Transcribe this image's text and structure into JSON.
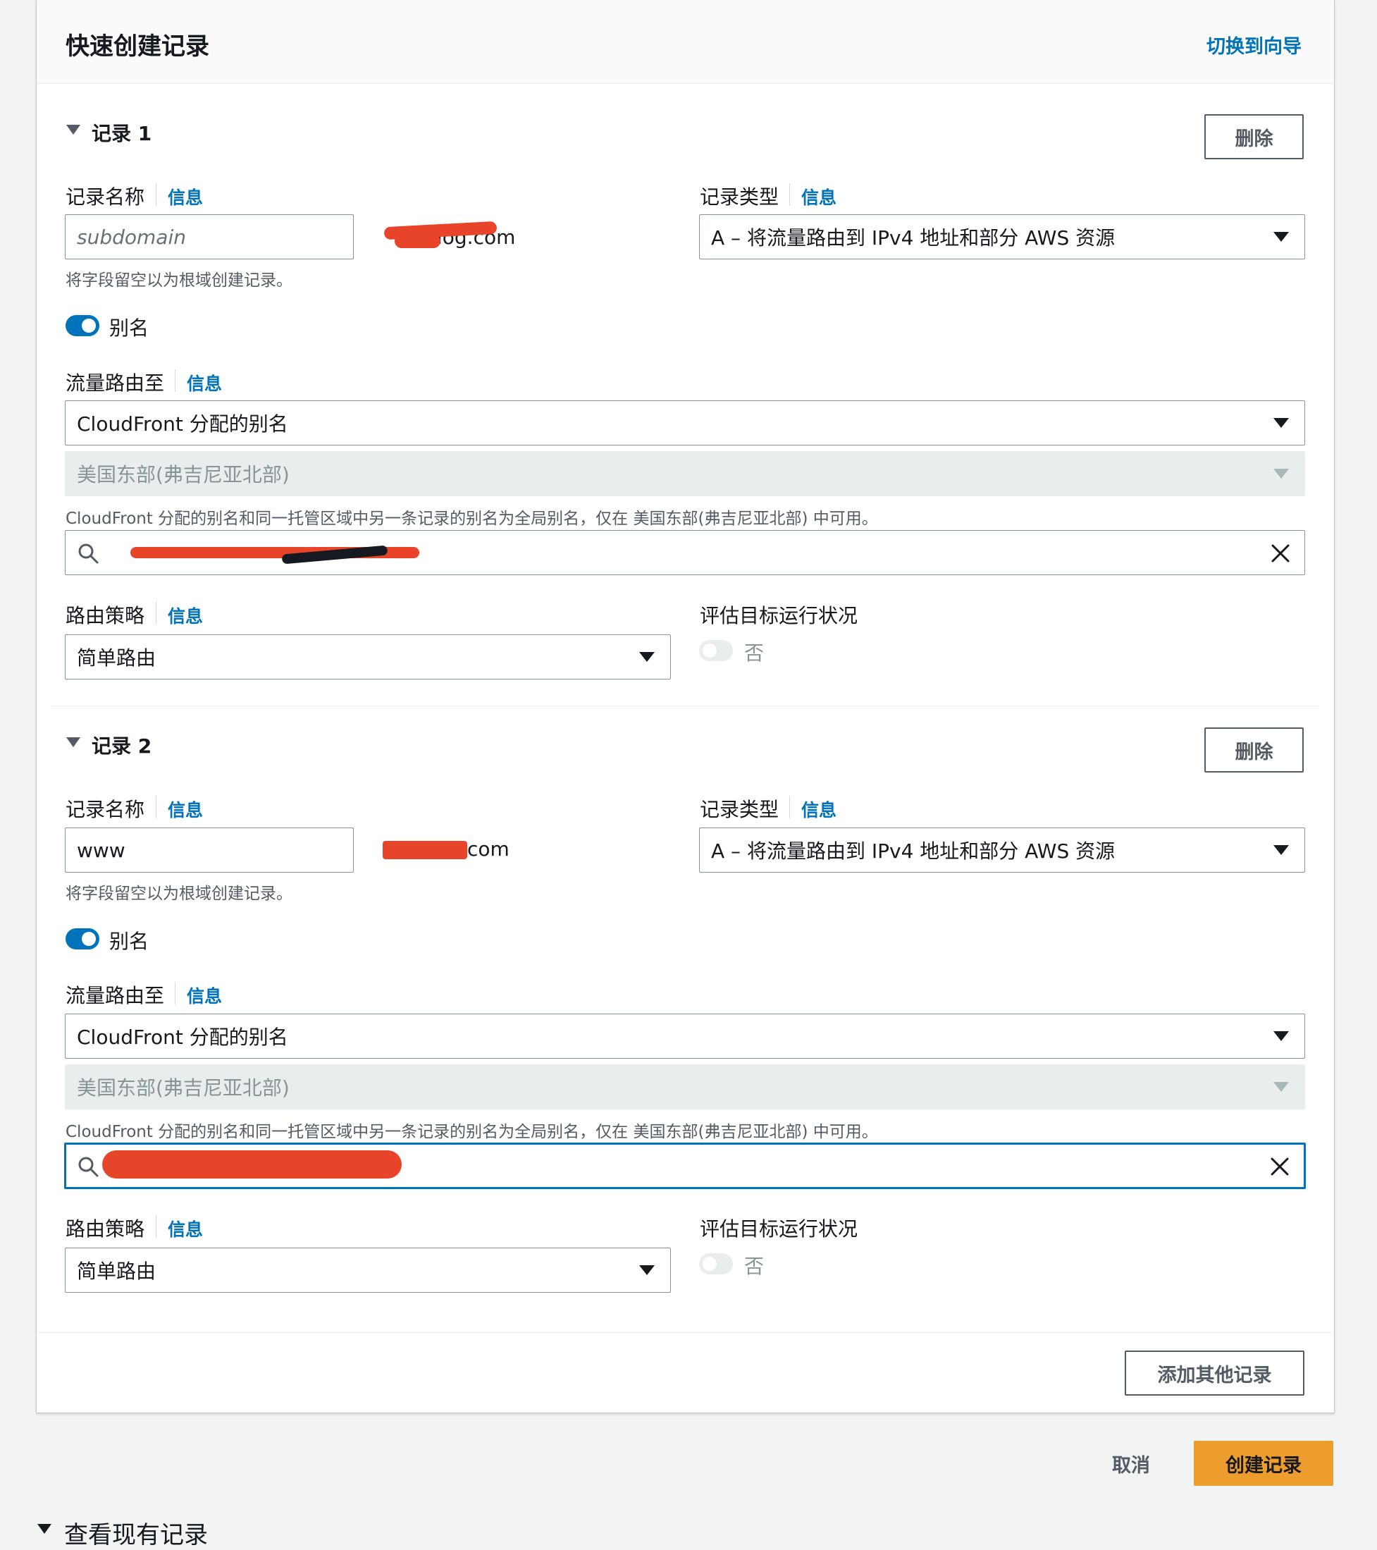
{
  "header": {
    "title": "快速创建记录",
    "switch_link": "切换到向导"
  },
  "common": {
    "info": "信息",
    "record_name_label": "记录名称",
    "record_type_label": "记录类型",
    "root_hint": "将字段留空以为根域创建记录。",
    "alias_label": "别名",
    "route_traffic_label": "流量路由至",
    "routing_policy_label": "路由策略",
    "evaluate_health_label": "评估目标运行状况",
    "evaluate_health_value": "否",
    "delete_button": "删除",
    "cloudfront_hint": "CloudFront 分配的别名和同一托管区域中另一条记录的别名为全局别名，仅在 美国东部(弗吉尼亚北部) 中可用。"
  },
  "records": [
    {
      "heading": "记录 1",
      "name_value": "",
      "name_placeholder": "subdomain",
      "domain_suffix": "log.com",
      "record_type": "A – 将流量路由到 IPv4 地址和部分 AWS 资源",
      "route_target": "CloudFront 分配的别名",
      "region": "美国东部(弗吉尼亚北部)",
      "routing_policy": "简单路由"
    },
    {
      "heading": "记录 2",
      "name_value": "www",
      "name_placeholder": "",
      "domain_suffix": "com",
      "record_type": "A – 将流量路由到 IPv4 地址和部分 AWS 资源",
      "route_target": "CloudFront 分配的别名",
      "region": "美国东部(弗吉尼亚北部)",
      "routing_policy": "简单路由"
    }
  ],
  "footer": {
    "add_record_button": "添加其他记录",
    "cancel_button": "取消",
    "create_button": "创建记录",
    "view_existing": "查看现有记录"
  },
  "colors": {
    "link": "#0073bb",
    "primary_button": "#ec9d2e",
    "redaction": "#e8442a"
  }
}
